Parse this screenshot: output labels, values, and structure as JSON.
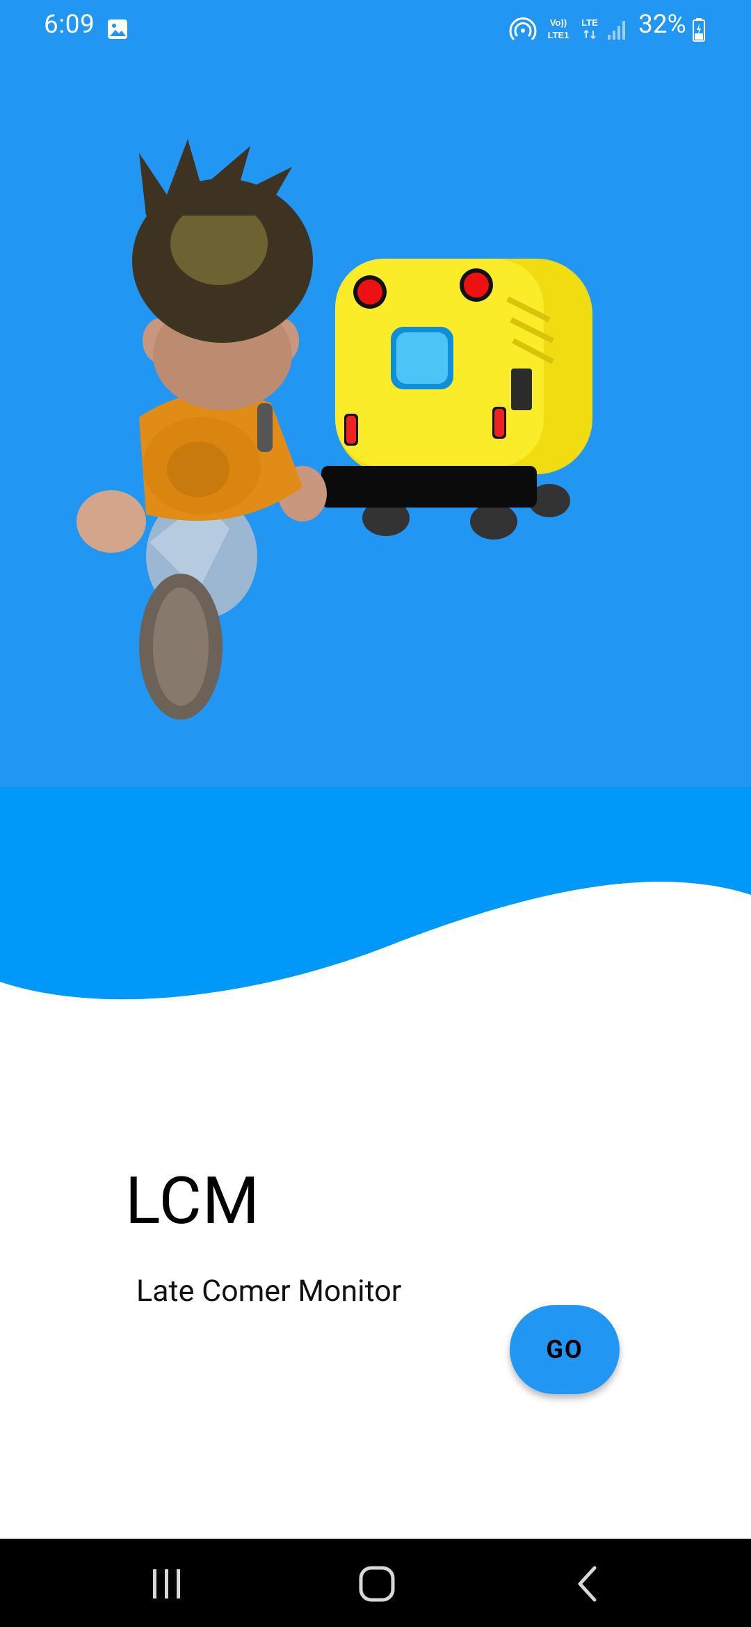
{
  "status_bar": {
    "time": "6:09",
    "battery_percent": "32%",
    "volte_label": "Vo)) LTE1",
    "lte_label": "LTE",
    "icons": [
      "gallery-icon",
      "hotspot-icon",
      "volte-icon",
      "lte-icon",
      "signal-icon",
      "battery-icon"
    ]
  },
  "splash": {
    "title": "LCM",
    "subtitle": "Late Comer Monitor",
    "go_label": "GO",
    "illustration": "boy-running-to-school-bus"
  },
  "nav_bar": {
    "buttons": [
      "recent-apps-icon",
      "home-icon",
      "back-icon"
    ]
  },
  "colors": {
    "primary": "#2196F3",
    "background": "#FFFFFF",
    "nav_background": "#000000"
  }
}
